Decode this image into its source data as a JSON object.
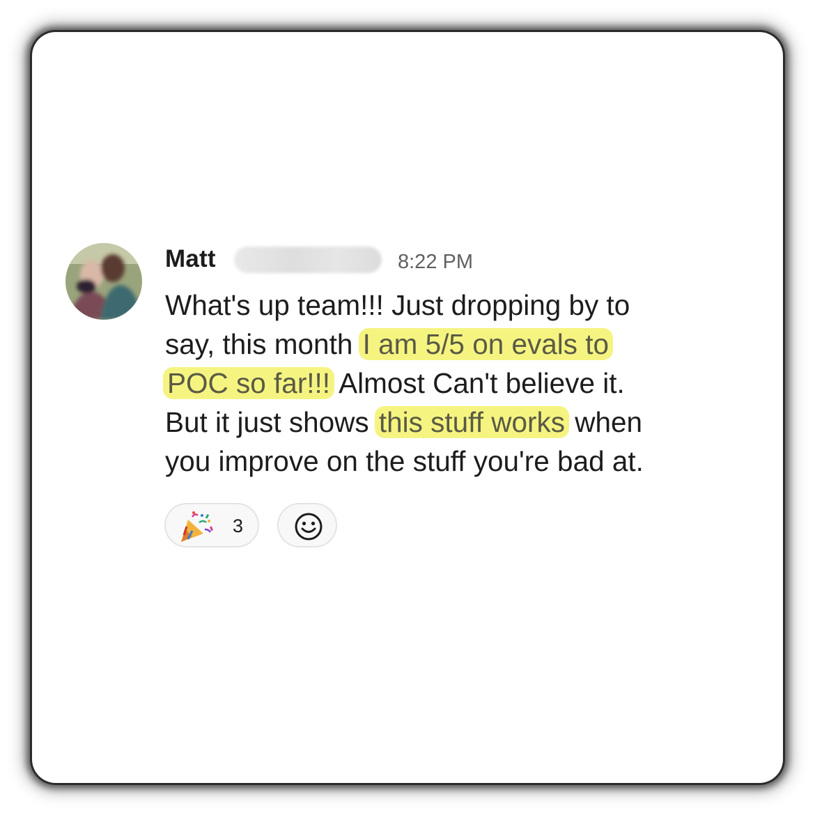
{
  "message": {
    "author": "Matt",
    "time": "8:22 PM",
    "lines": {
      "l1": "What's up team!!! Just dropping by to",
      "l2_pre": "say, this month ",
      "l2_hl": "I am 5/5 on evals to",
      "l3_hl": "POC so far!!!",
      "l3_post": " Almost Can't believe it.",
      "l4_pre": "But it just shows ",
      "l4_hl": "this stuff works",
      "l4_post": " when",
      "l5": "you improve on the stuff you're bad at."
    },
    "highlight_color": "#f5f481",
    "reactions": [
      {
        "emoji": "party-popper-icon",
        "count": "3"
      }
    ],
    "add_reaction_icon": "smiley-icon"
  }
}
